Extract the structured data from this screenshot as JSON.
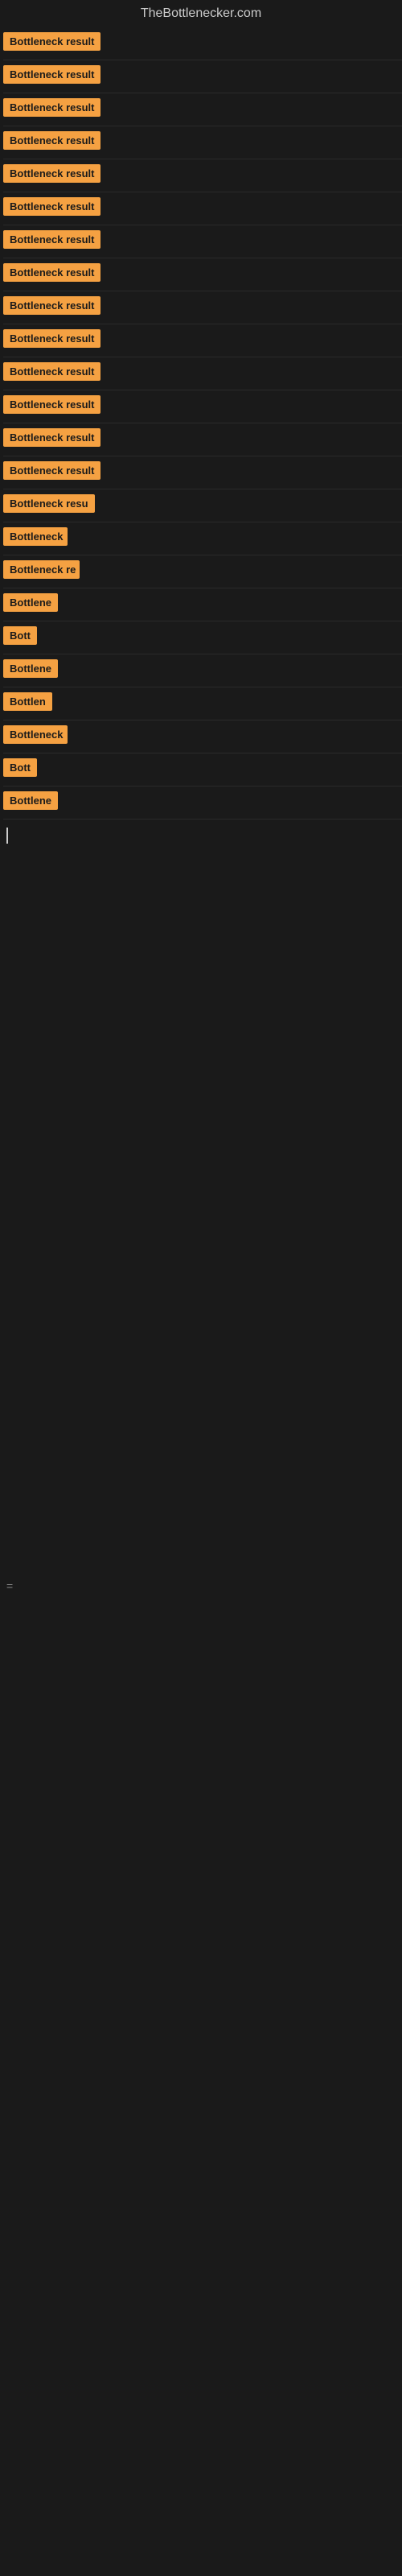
{
  "header": {
    "title": "TheBottlenecker.com"
  },
  "items": [
    {
      "id": 1,
      "label": "Bottleneck result",
      "width": 140
    },
    {
      "id": 2,
      "label": "Bottleneck result",
      "width": 140
    },
    {
      "id": 3,
      "label": "Bottleneck result",
      "width": 140
    },
    {
      "id": 4,
      "label": "Bottleneck result",
      "width": 140
    },
    {
      "id": 5,
      "label": "Bottleneck result",
      "width": 140
    },
    {
      "id": 6,
      "label": "Bottleneck result",
      "width": 140
    },
    {
      "id": 7,
      "label": "Bottleneck result",
      "width": 140
    },
    {
      "id": 8,
      "label": "Bottleneck result",
      "width": 140
    },
    {
      "id": 9,
      "label": "Bottleneck result",
      "width": 140
    },
    {
      "id": 10,
      "label": "Bottleneck result",
      "width": 140
    },
    {
      "id": 11,
      "label": "Bottleneck result",
      "width": 140
    },
    {
      "id": 12,
      "label": "Bottleneck result",
      "width": 140
    },
    {
      "id": 13,
      "label": "Bottleneck result",
      "width": 140
    },
    {
      "id": 14,
      "label": "Bottleneck result",
      "width": 140
    },
    {
      "id": 15,
      "label": "Bottleneck resu",
      "width": 115
    },
    {
      "id": 16,
      "label": "Bottleneck",
      "width": 80
    },
    {
      "id": 17,
      "label": "Bottleneck re",
      "width": 95
    },
    {
      "id": 18,
      "label": "Bottlene",
      "width": 70
    },
    {
      "id": 19,
      "label": "Bott",
      "width": 42
    },
    {
      "id": 20,
      "label": "Bottlene",
      "width": 70
    },
    {
      "id": 21,
      "label": "Bottlen",
      "width": 62
    },
    {
      "id": 22,
      "label": "Bottleneck",
      "width": 80
    },
    {
      "id": 23,
      "label": "Bott",
      "width": 42
    },
    {
      "id": 24,
      "label": "Bottlene",
      "width": 70
    }
  ],
  "colors": {
    "badge_bg": "#f5a142",
    "badge_text": "#1a1a1a",
    "background": "#1a1a1a",
    "title": "#cccccc"
  }
}
